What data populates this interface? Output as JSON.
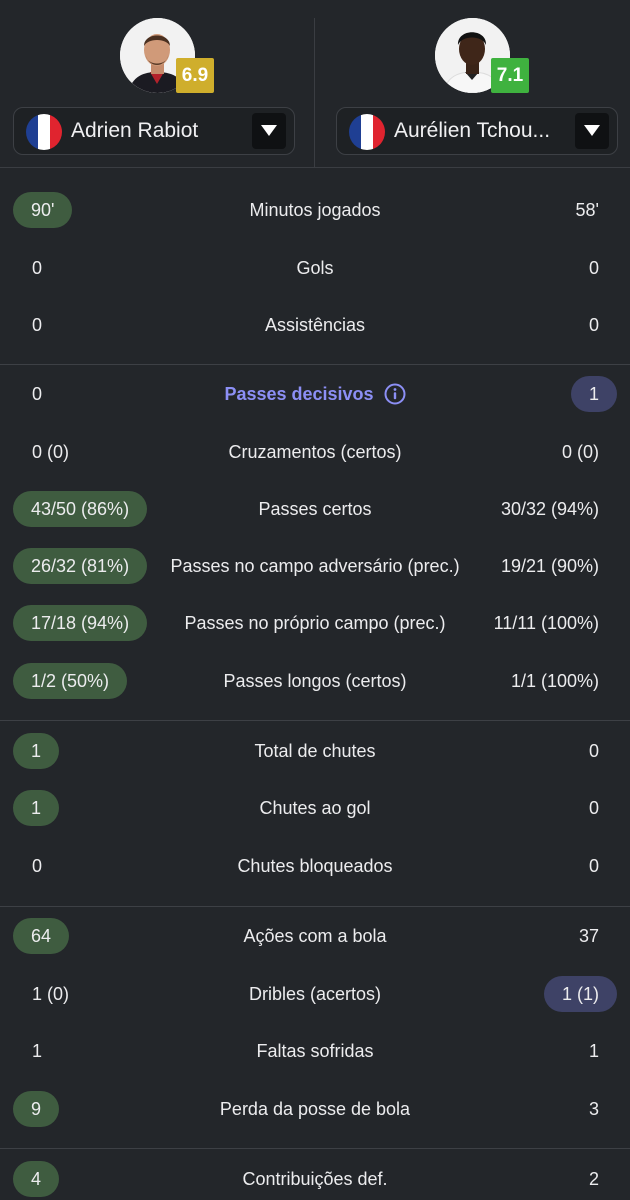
{
  "header": {
    "left_player": {
      "name": "Adrien Rabiot",
      "rating": "6.9",
      "rating_color": "#cfae2c",
      "flag": [
        "#1f3f93",
        "#ffffff",
        "#e0242f"
      ]
    },
    "right_player": {
      "name": "Aurélien Tchou...",
      "rating": "7.1",
      "rating_color": "#3fb23f",
      "flag": [
        "#1f3f93",
        "#ffffff",
        "#e0242f"
      ]
    }
  },
  "stats": [
    {
      "label": "Minutos jogados",
      "left": "90'",
      "right": "58'",
      "highlight": "left"
    },
    {
      "label": "Gols",
      "left": "0",
      "right": "0",
      "highlight": "none"
    },
    {
      "label": "Assistências",
      "left": "0",
      "right": "0",
      "highlight": "none"
    },
    {
      "label": "Passes decisivos",
      "left": "0",
      "right": "1",
      "highlight": "right",
      "link": true
    },
    {
      "label": "Cruzamentos (certos)",
      "left": "0 (0)",
      "right": "0 (0)",
      "highlight": "none"
    },
    {
      "label": "Passes certos",
      "left": "43/50 (86%)",
      "right": "30/32 (94%)",
      "highlight": "left"
    },
    {
      "label": "Passes no campo adversário (prec.)",
      "left": "26/32 (81%)",
      "right": "19/21 (90%)",
      "highlight": "left"
    },
    {
      "label": "Passes no próprio campo (prec.)",
      "left": "17/18 (94%)",
      "right": "11/11 (100%)",
      "highlight": "left"
    },
    {
      "label": "Passes longos (certos)",
      "left": "1/2 (50%)",
      "right": "1/1 (100%)",
      "highlight": "left"
    },
    {
      "label": "Total de chutes",
      "left": "1",
      "right": "0",
      "highlight": "left"
    },
    {
      "label": "Chutes ao gol",
      "left": "1",
      "right": "0",
      "highlight": "left"
    },
    {
      "label": "Chutes bloqueados",
      "left": "0",
      "right": "0",
      "highlight": "none"
    },
    {
      "label": "Ações com a bola",
      "left": "64",
      "right": "37",
      "highlight": "left"
    },
    {
      "label": "Dribles (acertos)",
      "left": "1 (0)",
      "right": "1 (1)",
      "highlight": "right"
    },
    {
      "label": "Faltas sofridas",
      "left": "1",
      "right": "1",
      "highlight": "none"
    },
    {
      "label": "Perda da posse de bola",
      "left": "9",
      "right": "3",
      "highlight": "left"
    },
    {
      "label": "Contribuições def.",
      "left": "4",
      "right": "2",
      "highlight": "left"
    }
  ],
  "colors": {
    "background": "#23262a",
    "win_left": "#3f5c40",
    "win_right": "#3e4266",
    "link": "#8c8ff5"
  },
  "icons": [
    "chevron-down-icon",
    "info-icon"
  ]
}
